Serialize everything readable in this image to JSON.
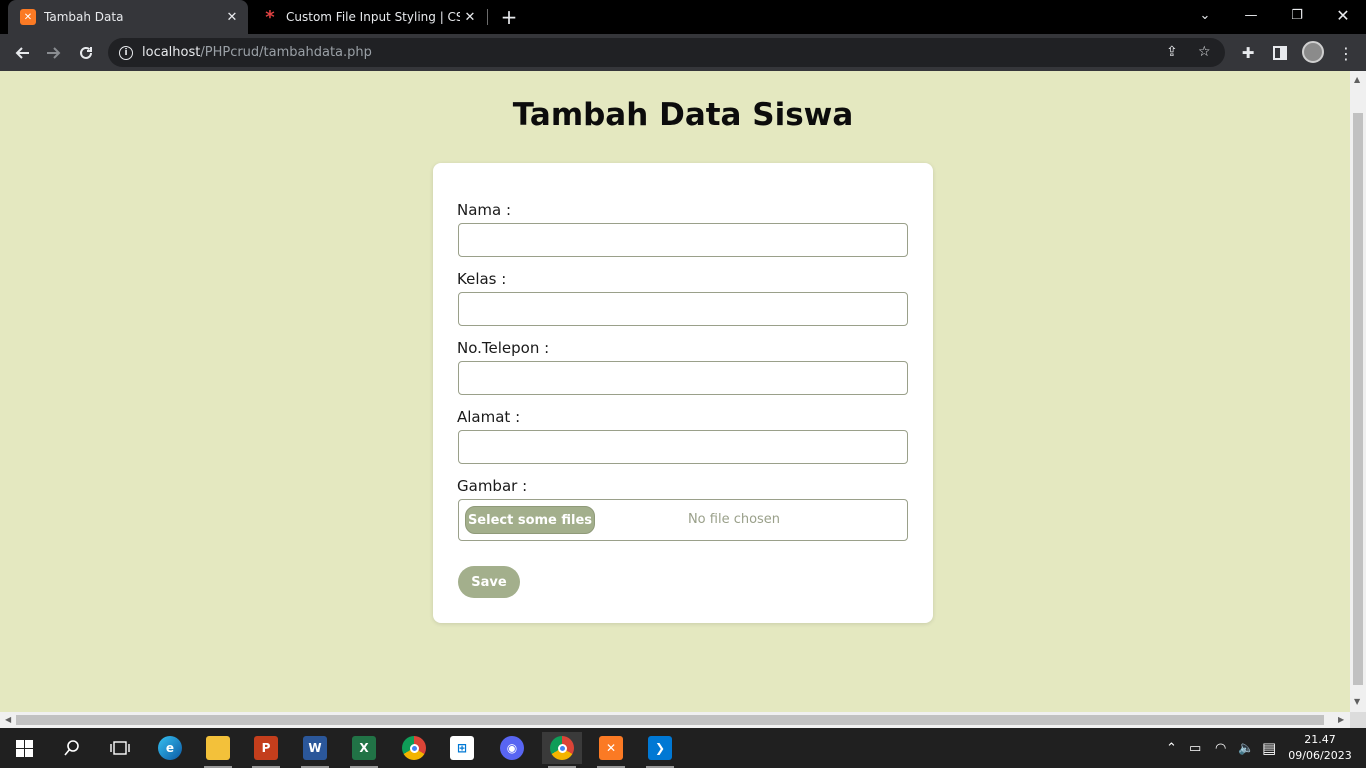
{
  "browser": {
    "tabs": [
      {
        "title": "Tambah Data",
        "icon": "xampp-icon",
        "active": true
      },
      {
        "title": "Custom File Input Styling | CSS-Tr",
        "icon": "css-tricks-icon",
        "active": false
      }
    ],
    "url_host": "localhost",
    "url_path": "/PHPcrud/tambahdata.php"
  },
  "page": {
    "title": "Tambah Data Siswa",
    "fields": [
      {
        "label": "Nama :",
        "value": ""
      },
      {
        "label": "Kelas :",
        "value": ""
      },
      {
        "label": "No.Telepon :",
        "value": ""
      },
      {
        "label": "Alamat :",
        "value": ""
      }
    ],
    "file_field": {
      "label": "Gambar :",
      "button_label": "Select some files",
      "status": "No file chosen"
    },
    "save_label": "Save"
  },
  "colors": {
    "page_background": "#e4e8c0",
    "accent": "#a3af8c"
  },
  "taskbar": {
    "apps": [
      "windows-start-icon",
      "search-icon",
      "task-view-icon",
      "edge-icon",
      "file-explorer-icon",
      "powerpoint-icon",
      "word-icon",
      "excel-icon",
      "chrome-icon",
      "microsoft-store-icon",
      "discord-icon",
      "chrome-profile-icon",
      "xampp-icon",
      "vscode-icon"
    ],
    "time": "21.47",
    "date": "09/06/2023"
  }
}
